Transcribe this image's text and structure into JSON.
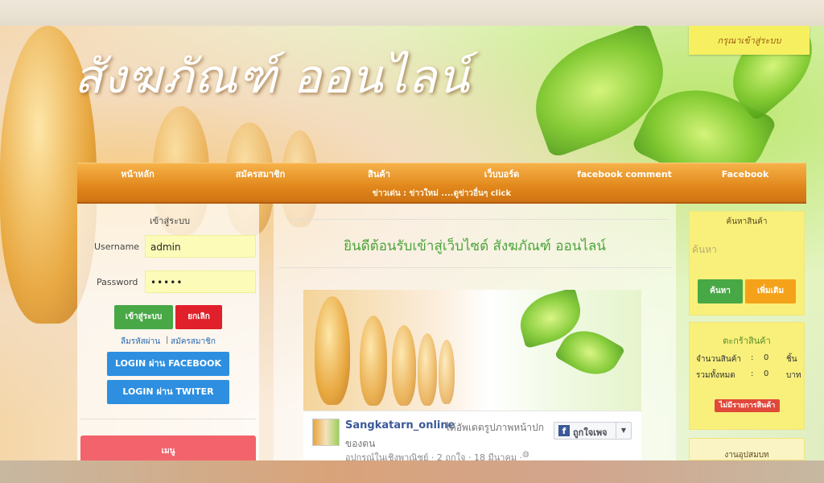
{
  "header": {
    "site_title": "สังฆภัณฑ์ ออนไลน์",
    "login_notice": "กรุณาเข้าสู่ระบบ"
  },
  "nav": {
    "items": [
      "หน้าหลัก",
      "สมัครสมาชิก",
      "สินค้า",
      "เว็บบอร์ด",
      "facebook comment",
      "Facebook"
    ],
    "ticker": "ข่าวเด่น : ข่าวใหม่ ....ดูข่าวอื่นๆ click"
  },
  "login": {
    "heading": "เข้าสู่ระบบ",
    "username_label": "Username",
    "username_value": "admin",
    "password_label": "Password",
    "password_value": "•••••",
    "login_button": "เข้าสู่ระบบ",
    "cancel_button": "ยกเลิก",
    "forgot_link": "ลืมรหัสผ่าน",
    "separator": "|",
    "register_link": "สมัครสมาชิก",
    "facebook_button": "LOGIN ผ่าน FACEBOOK",
    "twitter_button": "LOGIN ผ่าน TWITER",
    "menu_label": "เมนู"
  },
  "main": {
    "welcome": "ยินดีต้อนรับเข้าสู่เว็บไซต์ สังฆภัณฑ์ ออนไลน์",
    "fb_post": {
      "page_name": "Sangkatarn_online",
      "action": "ได้อัพเดตรูปภาพหน้าปก",
      "action_cont": "ของตน",
      "meta": "อุปกรณ์ในเชิงพาณิชย์ · 2 ถูกใจ · 18 มีนาคม ·",
      "like_button": "ถูกใจเพจ"
    }
  },
  "search": {
    "title": "ค้นหาสินค้า",
    "placeholder": "ค้นหา",
    "search_button": "ค้นหา",
    "more_button": "เพิ่มเติม"
  },
  "cart": {
    "title": "ตะกร้าสินค้า",
    "rows": [
      {
        "label": "จำนวนสินค้า",
        "colon": ":",
        "value": "0",
        "unit": "ชิ้น"
      },
      {
        "label": "รวมทั้งหมด",
        "colon": ":",
        "value": "0",
        "unit": "บาท"
      }
    ],
    "empty_badge": "ไม่มีรายการสินค้า"
  },
  "extra": {
    "title": "งานอุปสมบท"
  },
  "colors": {
    "nav_orange": "#e2891c",
    "green_button": "#47a845",
    "red_button": "#e0202a",
    "blue_button": "#2e8fe0",
    "orange_button": "#f5a21b",
    "yellow_box": "#f8f07a"
  }
}
